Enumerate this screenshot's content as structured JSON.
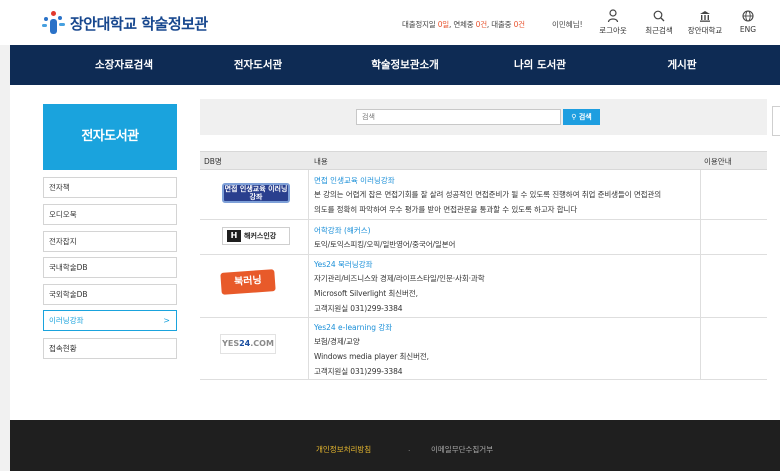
{
  "header": {
    "logo_text": "장안대학교 학술정보관",
    "status": {
      "prefix": "대출정지일 ",
      "suspend_days": "0일",
      "sep1": ", 연체중 ",
      "overdue": "0건",
      "sep2": ", 대출중 ",
      "loans": "0건"
    },
    "greeting": "이민혜님!",
    "utils": [
      {
        "label": "로그아웃",
        "icon": "logout-icon"
      },
      {
        "label": "최근검색",
        "icon": "search-icon"
      },
      {
        "label": "장안대학교",
        "icon": "university-icon"
      },
      {
        "label": "ENG",
        "icon": "globe-icon"
      }
    ]
  },
  "nav": {
    "items": [
      "소장자료검색",
      "전자도서관",
      "학술정보관소개",
      "나의 도서관",
      "게시판"
    ]
  },
  "sidebar": {
    "title": "전자도서관",
    "items": [
      {
        "label": "전자책"
      },
      {
        "label": "오디오북"
      },
      {
        "label": "전자잡지"
      },
      {
        "label": "국내학술DB"
      },
      {
        "label": "국외학술DB"
      },
      {
        "label": "이러닝강좌",
        "active": true,
        "arrow": ">"
      },
      {
        "label": "접속현황"
      }
    ]
  },
  "search": {
    "placeholder": "검색",
    "button_label": "검색"
  },
  "table": {
    "headers": {
      "db": "DB명",
      "content": "내용",
      "guide": "이용안내"
    },
    "rows": [
      {
        "logo_text": "면접 인생교육 이러닝강좌",
        "title": "면접 인생교육 이러닝강좌",
        "lines": [
          "본 강의는 어렵게 잡은 면접기회를 잘 살려 성공적인 면접준비가 될 수 있도록 진행하여 취업 준비생들이 면접관의",
          "의도를 정확히 파악하여 우수 평가를 받아 면접관문을 통과할 수 있도록 하고자 합니다"
        ]
      },
      {
        "logo_text": "해커스인강",
        "title": "어학강좌 (해커스)",
        "lines": [
          "토익/토익스피킹/오픽/일반영어/중국어/일본어"
        ]
      },
      {
        "logo_text": "북러닝",
        "title": "Yes24 북러닝강좌",
        "lines": [
          "자기관리/비즈니스와 경제/라이프스타일/인문·사회·과학",
          "Microsoft Silverlight 최신버전,",
          "고객지원실 031)299-3384"
        ]
      },
      {
        "logo_text_a": "YES",
        "logo_text_b": "24",
        "logo_text_c": ".COM",
        "title": "Yes24 e-learning 강좌",
        "lines": [
          "보험/경제/교양",
          "Windows media player 최신버전,",
          "고객지원실 031)299-3384"
        ]
      }
    ]
  },
  "footer": {
    "privacy": "개인정보처리방침",
    "separator": ".",
    "email_policy": "이메일무단수집거부"
  },
  "colors": {
    "nav_bg": "#0e2b54",
    "accent": "#1aa3dd",
    "link": "#1a8fd8",
    "footer_bg": "#1f1f1f",
    "footer_highlight": "#e8b92f",
    "status_red": "#e8542f"
  }
}
